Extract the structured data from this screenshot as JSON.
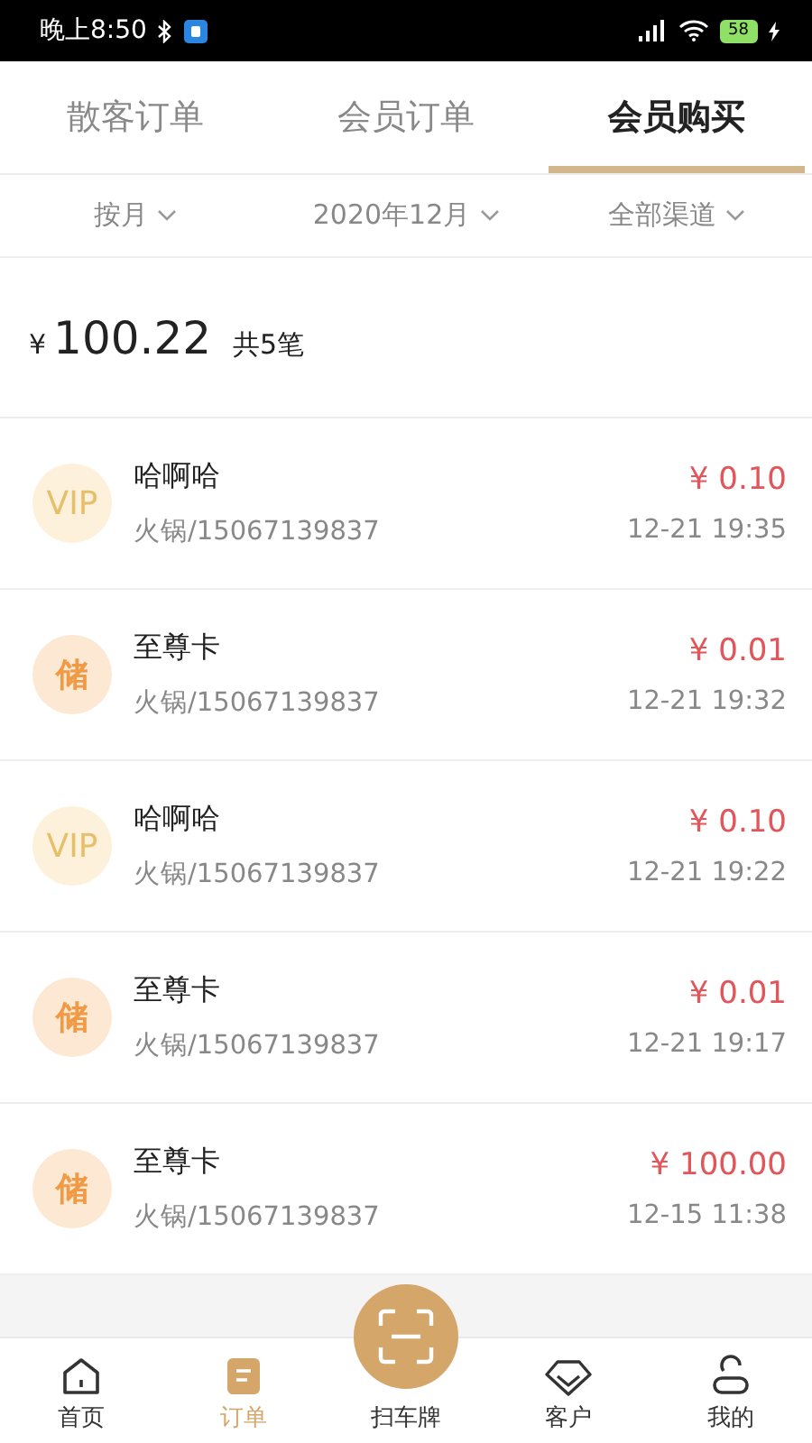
{
  "status_bar": {
    "time": "晚上8:50",
    "battery": "58"
  },
  "tabs": [
    {
      "label": "散客订单",
      "selected": false
    },
    {
      "label": "会员订单",
      "selected": false
    },
    {
      "label": "会员购买",
      "selected": true
    }
  ],
  "filters": [
    "按月",
    "2020年12月",
    "全部渠道"
  ],
  "summary": {
    "currency": "¥",
    "total": "100.22",
    "count": "共5笔"
  },
  "orders": [
    {
      "badge": "VIP",
      "kind": "vip",
      "name": "哈啊哈",
      "detail": "火锅/15067139837",
      "amount": "¥ 0.10",
      "time": "12-21 19:35"
    },
    {
      "badge": "储",
      "kind": "stored",
      "name": "至尊卡",
      "detail": "火锅/15067139837",
      "amount": "¥ 0.01",
      "time": "12-21 19:32"
    },
    {
      "badge": "VIP",
      "kind": "vip",
      "name": "哈啊哈",
      "detail": "火锅/15067139837",
      "amount": "¥ 0.10",
      "time": "12-21 19:22"
    },
    {
      "badge": "储",
      "kind": "stored",
      "name": "至尊卡",
      "detail": "火锅/15067139837",
      "amount": "¥ 0.01",
      "time": "12-21 19:17"
    },
    {
      "badge": "储",
      "kind": "stored",
      "name": "至尊卡",
      "detail": "火锅/15067139837",
      "amount": "¥ 100.00",
      "time": "12-15 11:38"
    }
  ],
  "nav": [
    {
      "label": "首页",
      "kind": "home",
      "selected": false
    },
    {
      "label": "订单",
      "kind": "orders",
      "selected": true
    },
    {
      "label": "扫车牌",
      "kind": "scan",
      "selected": false
    },
    {
      "label": "客户",
      "kind": "customers",
      "selected": false
    },
    {
      "label": "我的",
      "kind": "me",
      "selected": false
    }
  ]
}
